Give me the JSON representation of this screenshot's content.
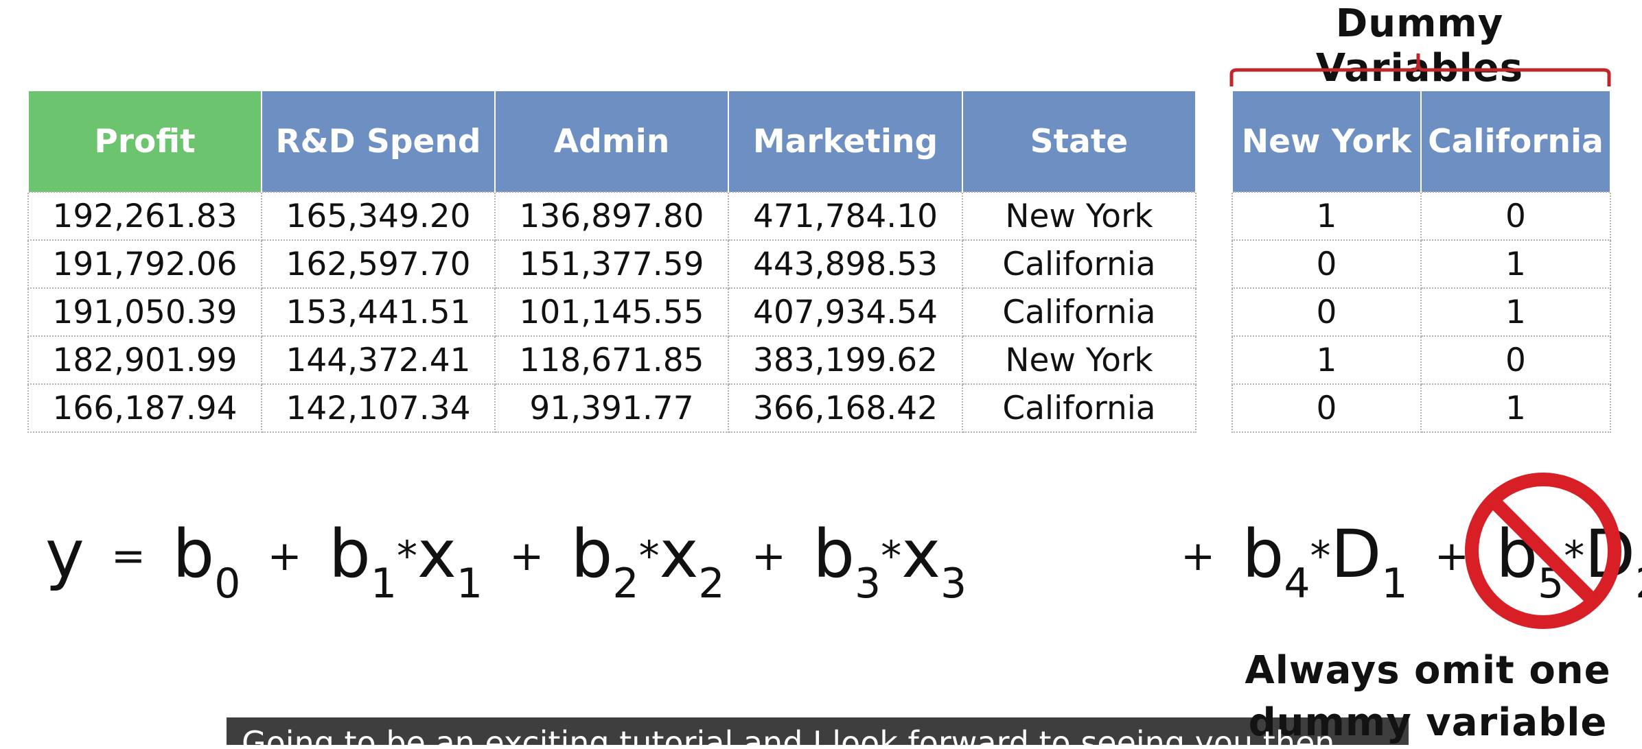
{
  "table": {
    "headers": [
      "Profit",
      "R&D Spend",
      "Admin",
      "Marketing",
      "State"
    ],
    "rows": [
      [
        "192,261.83",
        "165,349.20",
        "136,897.80",
        "471,784.10",
        "New York"
      ],
      [
        "191,792.06",
        "162,597.70",
        "151,377.59",
        "443,898.53",
        "California"
      ],
      [
        "191,050.39",
        "153,441.51",
        "101,145.55",
        "407,934.54",
        "California"
      ],
      [
        "182,901.99",
        "144,372.41",
        "118,671.85",
        "383,199.62",
        "New York"
      ],
      [
        "166,187.94",
        "142,107.34",
        "91,391.77",
        "366,168.42",
        "California"
      ]
    ],
    "colors": {
      "dependent_header": "#6cc56e",
      "independent_header": "#6e8fc1"
    }
  },
  "dummy": {
    "title": "Dummy Variables",
    "headers": [
      "New York",
      "California"
    ],
    "rows": [
      [
        "1",
        "0"
      ],
      [
        "0",
        "1"
      ],
      [
        "0",
        "1"
      ],
      [
        "1",
        "0"
      ],
      [
        "0",
        "1"
      ]
    ],
    "brace_color": "#c0272d"
  },
  "equation": {
    "y": "y",
    "eq": "=",
    "plus": "+",
    "times": "*",
    "b": "b",
    "x": "x",
    "D": "D",
    "subs": {
      "s0": "0",
      "s1": "1",
      "s2": "2",
      "s3": "3",
      "s4": "4",
      "s5": "5"
    }
  },
  "note": {
    "line1": "Always omit one",
    "line2": "dummy variable",
    "sign_color": "#d81f26",
    "sign_icon": "prohibited-icon"
  },
  "caption": {
    "text": "Going to be an exciting tutorial and I look forward to seeing you then."
  }
}
